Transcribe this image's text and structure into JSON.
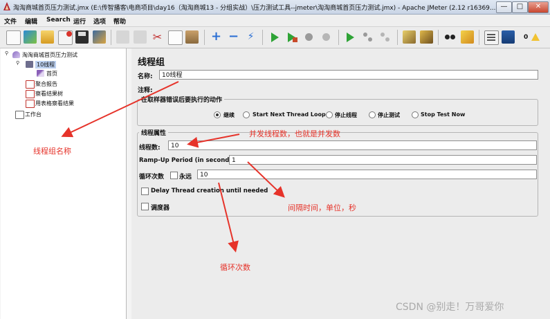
{
  "window": {
    "title": "淘淘商城首页压力测试.jmx (E:\\传智播客\\电商项目\\day16（淘淘商城13 - 分组实战）\\压力测试工具--jmeter\\淘淘商城首页压力测试.jmx) - Apache JMeter (2.12 r16369...",
    "minimize": "—",
    "maximize": "□",
    "close": "✕"
  },
  "menu": [
    "文件",
    "编辑",
    "Search",
    "运行",
    "选项",
    "帮助"
  ],
  "toolbar": {
    "icons": [
      "new-icon",
      "templates-icon",
      "open-icon",
      "close-file-icon",
      "save-icon",
      "save-screenshot-icon",
      "undo-icon",
      "redo-icon",
      "cut-icon",
      "copy-icon",
      "paste-icon",
      "expand-icon",
      "collapse-icon",
      "toggle-icon",
      "start-icon",
      "start-no-pause-icon",
      "stop-icon",
      "shutdown-icon",
      "remote-start-icon",
      "remote-stop-icon",
      "remote-shutdown-icon",
      "clear-icon",
      "clear-all-icon",
      "search-icon",
      "reset-search-icon",
      "function-helper-icon",
      "help-icon"
    ],
    "error_count": "0"
  },
  "tree": {
    "items": [
      {
        "label": "淘淘商城首页压力测试",
        "icon": "test-plan-icon"
      },
      {
        "label": "10线程",
        "icon": "thread-group-icon"
      },
      {
        "label": "首页",
        "icon": "http-sampler-icon"
      },
      {
        "label": "聚合报告",
        "icon": "listener-icon"
      },
      {
        "label": "察看结果树",
        "icon": "listener-icon"
      },
      {
        "label": "用表格察看结果",
        "icon": "listener-icon"
      },
      {
        "label": "工作台",
        "icon": "workbench-icon"
      }
    ]
  },
  "panel": {
    "title": "线程组",
    "name_label": "名称:",
    "name_value": "10线程",
    "comment_label": "注释:",
    "error_group": {
      "legend": "在取样器错误后要执行的动作",
      "options": [
        "继续",
        "Start Next Thread Loop",
        "停止线程",
        "停止测试",
        "Stop Test Now"
      ],
      "selected": "继续"
    },
    "thread_group": {
      "legend": "线程属性",
      "threads_label": "线程数:",
      "threads_value": "10",
      "rampup_label": "Ramp-Up Period (in seconds):",
      "rampup_value": "1",
      "loop_label": "循环次数",
      "forever_label": "永远",
      "loop_value": "10",
      "delay_label": "Delay Thread creation until needed",
      "scheduler_label": "调度器"
    }
  },
  "annotations": {
    "thread_group_name": "线程组名称",
    "thread_count": "并发线程数，也就是并发数",
    "interval": "间隔时间，单位，秒",
    "loop_count": "循环次数"
  },
  "watermark": "CSDN @别走！万哥爱你",
  "colors": {
    "annotation": "#e6332a",
    "selection": "#bcd0f0",
    "panel_bg": "#ececec"
  }
}
